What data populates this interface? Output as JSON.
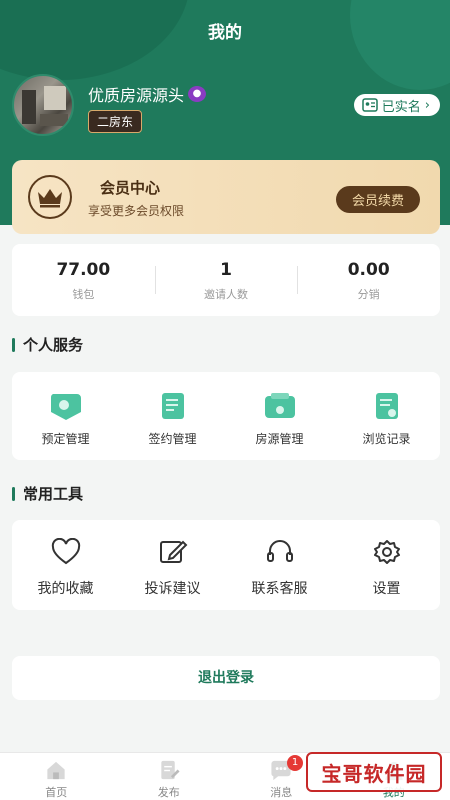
{
  "header": {
    "title": "我的"
  },
  "user": {
    "name": "优质房源源头",
    "emoji": "😈",
    "role": "二房东",
    "verify_label": "已实名"
  },
  "vip": {
    "title": "会员中心",
    "subtitle": "享受更多会员权限",
    "button": "会员续费"
  },
  "stats": [
    {
      "value": "77.00",
      "label": "钱包"
    },
    {
      "value": "1",
      "label": "邀请人数"
    },
    {
      "value": "0.00",
      "label": "分销"
    }
  ],
  "services": {
    "title": "个人服务",
    "items": [
      {
        "label": "预定管理",
        "icon": "booking-icon"
      },
      {
        "label": "签约管理",
        "icon": "contract-icon"
      },
      {
        "label": "房源管理",
        "icon": "property-icon"
      },
      {
        "label": "浏览记录",
        "icon": "history-icon"
      }
    ]
  },
  "tools": {
    "title": "常用工具",
    "items": [
      {
        "label": "我的收藏",
        "icon": "heart-icon"
      },
      {
        "label": "投诉建议",
        "icon": "edit-icon"
      },
      {
        "label": "联系客服",
        "icon": "headset-icon"
      },
      {
        "label": "设置",
        "icon": "gear-icon"
      }
    ]
  },
  "logout_label": "退出登录",
  "tabbar": [
    {
      "label": "首页",
      "icon": "home-icon"
    },
    {
      "label": "发布",
      "icon": "publish-icon"
    },
    {
      "label": "消息",
      "icon": "message-icon",
      "badge": "1"
    },
    {
      "label": "我的",
      "icon": "profile-icon"
    }
  ],
  "watermark": "宝哥软件园",
  "colors": {
    "primary": "#1f7a5c",
    "gold": "#f1d9ae",
    "badge": "#e53935"
  }
}
